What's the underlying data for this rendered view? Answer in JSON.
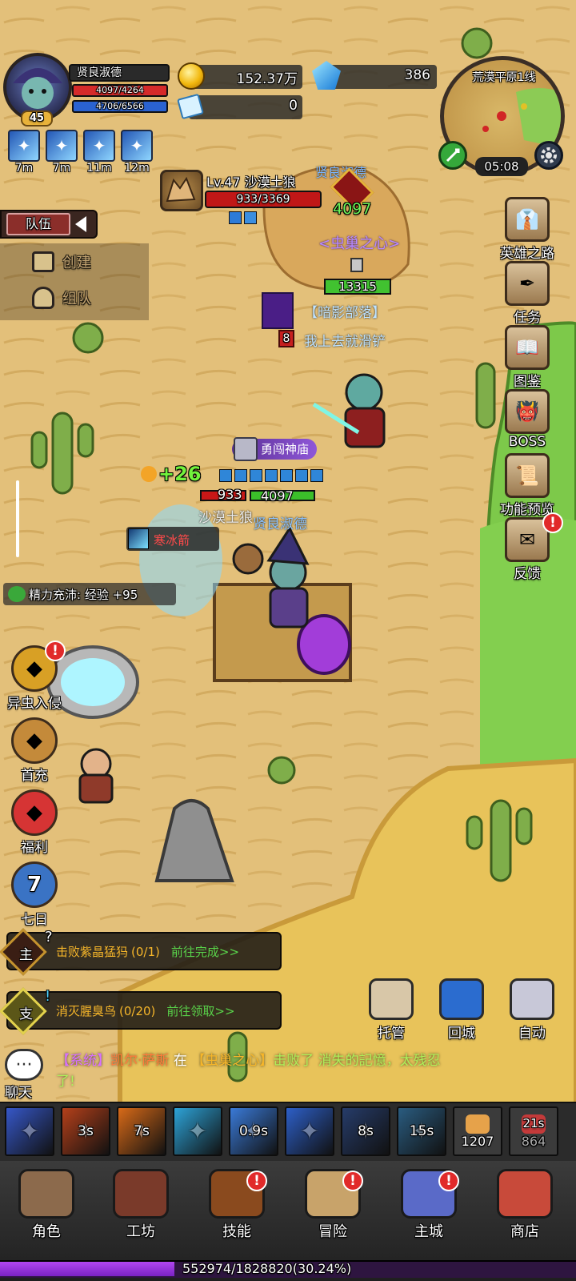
{
  "player": {
    "name": "贤良淑德",
    "level": "45",
    "hp": "4097/4264",
    "mp": "4706/6566",
    "hp_fraction": 0.96,
    "mp_fraction": 0.72
  },
  "buffs": [
    {
      "icon": "wing-icon",
      "timer": "7m"
    },
    {
      "icon": "eye-icon",
      "timer": "7m"
    },
    {
      "icon": "wind-icon",
      "timer": "11m"
    },
    {
      "icon": "crystal-icon",
      "timer": "12m"
    }
  ],
  "currency": {
    "gold": "152.37万",
    "gems": "386",
    "tickets": "0"
  },
  "minimap": {
    "name": "荒漠平原1线",
    "clock": "05:08"
  },
  "target": {
    "name": "Lv.47 沙漠土狼",
    "hp": "933/3369",
    "hp_fraction": 0.28
  },
  "team": {
    "tab": "队伍",
    "create": "创建",
    "group": "组队"
  },
  "right_menu": [
    {
      "label": "英雄之路",
      "icon": "tie-icon",
      "alert": false
    },
    {
      "label": "任务",
      "icon": "feather-scroll-icon",
      "alert": false
    },
    {
      "label": "图鉴",
      "icon": "book-icon",
      "alert": false
    },
    {
      "label": "BOSS",
      "icon": "boss-icon",
      "alert": false
    },
    {
      "label": "功能预览",
      "icon": "preview-scroll-icon",
      "alert": false
    },
    {
      "label": "反馈",
      "icon": "letter-icon",
      "alert": true
    }
  ],
  "left_menu": [
    {
      "label": "异虫入侵",
      "icon": "bug-medal-icon",
      "alert": true
    },
    {
      "label": "首充",
      "icon": "money-bag-icon",
      "alert": false
    },
    {
      "label": "福利",
      "icon": "gift-box-icon",
      "alert": false
    },
    {
      "label": "七日",
      "icon": "seven-day-shield-icon",
      "alert": false,
      "number": "7"
    }
  ],
  "world": {
    "other_player_name": "贤良淑德",
    "other_player_power": "4097",
    "guild1": "<虫巢之心>",
    "power_bar": "13315",
    "guild2": "【暗影部落】",
    "other_player2": "我上去就滑铲",
    "flag_number": "8",
    "temple_tag": "勇闯神庙",
    "heal_text": "+26",
    "enemy_hp": "933",
    "self_hp": "4097",
    "enemy_label": "沙漠土狼",
    "self_label": "贤良淑德",
    "skill_popup": "寒冰箭",
    "energy_msg": "精力充沛: 经验 +95"
  },
  "quests": [
    {
      "badge": "主",
      "title": "击败紫晶猛犸",
      "progress": "(0/1)",
      "action": "前往完成>>",
      "mark": "?"
    },
    {
      "badge": "支",
      "title": "消灭腥臭鸟",
      "progress": "(0/20)",
      "action": "前往领取>>",
      "mark": "!"
    }
  ],
  "actions": [
    {
      "label": "托管",
      "icon": "chat-dots-icon"
    },
    {
      "label": "回城",
      "icon": "portal-icon"
    },
    {
      "label": "自动",
      "icon": "crossed-swords-icon"
    }
  ],
  "chat": {
    "label": "聊天",
    "system": "【系统】",
    "player": "凯尔·萨斯",
    "at": "在",
    "guild": "【虫巢之心】",
    "msg1": "击败了 消失的記憶，太残忍",
    "msg2": "了!"
  },
  "skills": [
    {
      "icon": "ice-lance-icon",
      "cd": ""
    },
    {
      "icon": "fire-fist-icon",
      "cd": "3s"
    },
    {
      "icon": "flame-icon",
      "cd": "7s"
    },
    {
      "icon": "wave-eye-icon",
      "cd": ""
    },
    {
      "icon": "frost-nova-icon",
      "cd": "0.9s"
    },
    {
      "icon": "wing-burst-icon",
      "cd": ""
    },
    {
      "icon": "claw-icon",
      "cd": "8s"
    },
    {
      "icon": "shield-wave-icon",
      "cd": "15s"
    }
  ],
  "items": [
    {
      "icon": "bread-icon",
      "count": "1207"
    },
    {
      "icon": "potion-icon",
      "cd": "21s",
      "count": "864"
    }
  ],
  "nav": [
    {
      "label": "角色",
      "icon": "hero-portrait-icon",
      "alert": false
    },
    {
      "label": "工坊",
      "icon": "anvil-icon",
      "alert": false
    },
    {
      "label": "技能",
      "icon": "spellbook-icon",
      "alert": true
    },
    {
      "label": "冒险",
      "icon": "map-scroll-icon",
      "alert": true
    },
    {
      "label": "主城",
      "icon": "castle-icon",
      "alert": true
    },
    {
      "label": "商店",
      "icon": "shop-icon",
      "alert": false
    }
  ],
  "xp": {
    "text": "552974/1828820(30.24%)",
    "fraction": 0.3024
  },
  "colors": {
    "sand": "#e5c27a",
    "grass": "#7dc94a",
    "gold": "#f2b80e",
    "hp": "#d52a2a",
    "mp": "#2a62d0",
    "xp": "#9c38e0",
    "quest_green": "#59d24a"
  }
}
